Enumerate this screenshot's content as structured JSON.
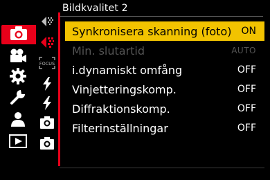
{
  "page_title": "Bildkvalitet 2",
  "colors": {
    "accent_red": "#e8001a",
    "selection_yellow": "#f2c300",
    "text_white": "#ffffff",
    "text_disabled": "#555555"
  },
  "category_tabs": [
    {
      "icon": "camera-icon",
      "active": true
    },
    {
      "icon": "movie-camera-icon",
      "active": false
    },
    {
      "icon": "gear-icon",
      "active": false
    },
    {
      "icon": "wrench-icon",
      "active": false
    },
    {
      "icon": "person-icon",
      "active": false
    },
    {
      "icon": "playback-icon",
      "active": false
    }
  ],
  "sub_tabs": [
    {
      "icon": "quality-icon",
      "active": false
    },
    {
      "icon": "quality-icon",
      "active": true
    },
    {
      "icon": "focus-icon",
      "label": "FOCUS",
      "active": false
    },
    {
      "icon": "flash-icon",
      "active": false
    },
    {
      "icon": "flash-icon",
      "active": false
    },
    {
      "icon": "camera-settings-icon",
      "active": false
    },
    {
      "icon": "camera-settings-icon",
      "active": false
    }
  ],
  "menu_items": [
    {
      "label": "Synkronisera skanning (foto)",
      "value": "ON",
      "selected": true,
      "disabled": false
    },
    {
      "label": "Min. slutartid",
      "value": "AUTO",
      "selected": false,
      "disabled": true
    },
    {
      "label": "i.dynamiskt omfång",
      "value": "OFF",
      "selected": false,
      "disabled": false
    },
    {
      "label": "Vinjetteringskomp.",
      "value": "OFF",
      "selected": false,
      "disabled": false
    },
    {
      "label": "Diffraktionskomp.",
      "value": "OFF",
      "selected": false,
      "disabled": false
    },
    {
      "label": "Filterinställningar",
      "value": "OFF",
      "selected": false,
      "disabled": false
    }
  ]
}
